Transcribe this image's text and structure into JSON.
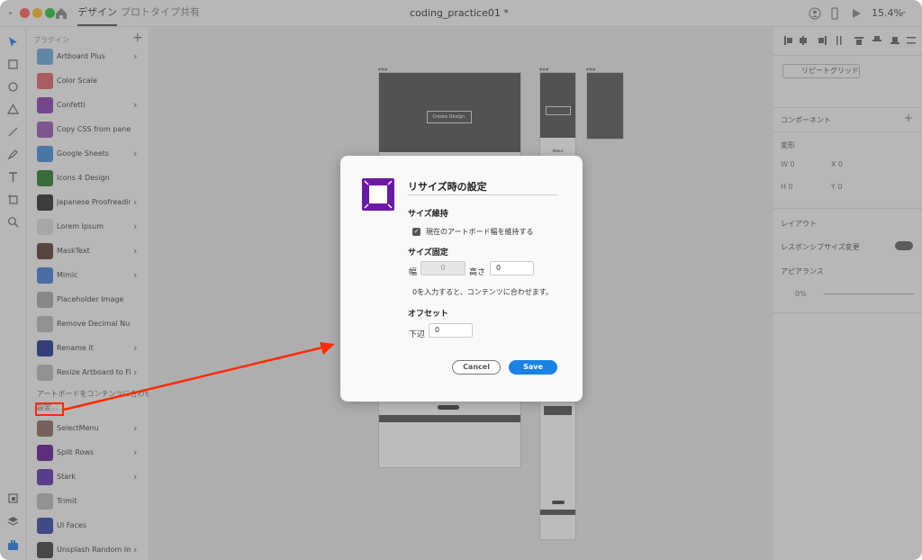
{
  "titlebar": {
    "tabs": [
      {
        "label": "デザイン"
      },
      {
        "label": "プロトタイプ"
      },
      {
        "label": "共有"
      }
    ],
    "document_title": "coding_practice01 *",
    "zoom": "15.4%"
  },
  "plugins": {
    "header": "プラグイン",
    "items": [
      {
        "label": "Artboard Plus",
        "has_arrow": true,
        "color": "#6fa8dc"
      },
      {
        "label": "Color Scale",
        "has_arrow": false,
        "color": "#e06666"
      },
      {
        "label": "Confetti",
        "has_arrow": true,
        "color": "#8e44ad"
      },
      {
        "label": "Copy CSS from panel",
        "has_arrow": false,
        "color": "#9b59b6"
      },
      {
        "label": "Google Sheets",
        "has_arrow": true,
        "color": "#4a90d9"
      },
      {
        "label": "Icons 4 Design",
        "has_arrow": false,
        "color": "#2e7d32"
      },
      {
        "label": "Japanese Proofreading",
        "has_arrow": true,
        "color": "#333333"
      },
      {
        "label": "Lorem Ipsum",
        "has_arrow": true,
        "color": "#dddddd"
      },
      {
        "label": "MaskText",
        "has_arrow": true,
        "color": "#5d4037"
      },
      {
        "label": "Mimic",
        "has_arrow": true,
        "color": "#4a7fd9"
      },
      {
        "label": "Placeholder Image",
        "has_arrow": false,
        "color": "#aaaaaa"
      },
      {
        "label": "Remove Decimal Numbers",
        "has_arrow": false,
        "color": "#bbbbbb"
      },
      {
        "label": "Rename it",
        "has_arrow": true,
        "color": "#283593"
      },
      {
        "label": "Resize Artboard to Fit...",
        "has_arrow": true,
        "color": "#bbbbbb"
      }
    ],
    "sub_items": [
      {
        "label": "アートボードをコンテンツに合わせる"
      },
      {
        "label": "設定..."
      }
    ],
    "items_after": [
      {
        "label": "SelectMenu",
        "has_arrow": true,
        "color": "#8d6e63"
      },
      {
        "label": "Split Rows",
        "has_arrow": true,
        "color": "#6a1b9a"
      },
      {
        "label": "Stark",
        "has_arrow": true,
        "color": "#5e35b1"
      },
      {
        "label": "Trimit",
        "has_arrow": false,
        "color": "#bbbbbb"
      },
      {
        "label": "UI Faces",
        "has_arrow": false,
        "color": "#3949ab"
      },
      {
        "label": "Unsplash Random Ima...",
        "has_arrow": true,
        "color": "#444444"
      }
    ]
  },
  "canvas": {
    "hero_text": "Create Design.",
    "about_label": "About"
  },
  "right_panel": {
    "repeat_grid": "リピートグリッド",
    "components": "コンポーネント",
    "transform": "変形",
    "w": "W 0",
    "x": "X 0",
    "h": "H 0",
    "y": "Y 0",
    "layout": "レイアウト",
    "responsive": "レスポンシブサイズ変更",
    "appearance": "アピアランス",
    "opacity": "0%"
  },
  "dialog": {
    "title": "リサイズ時の設定",
    "section_keep": "サイズ維持",
    "checkbox_label": "現在のアートボード幅を維持する",
    "section_fixed": "サイズ固定",
    "width_label": "幅",
    "width_value": "0",
    "height_label": "高さ",
    "height_value": "0",
    "note": "0を入力すると、コンテンツに合わせます。",
    "section_offset": "オフセット",
    "bottom_label": "下辺",
    "bottom_value": "0",
    "cancel": "Cancel",
    "save": "Save"
  }
}
